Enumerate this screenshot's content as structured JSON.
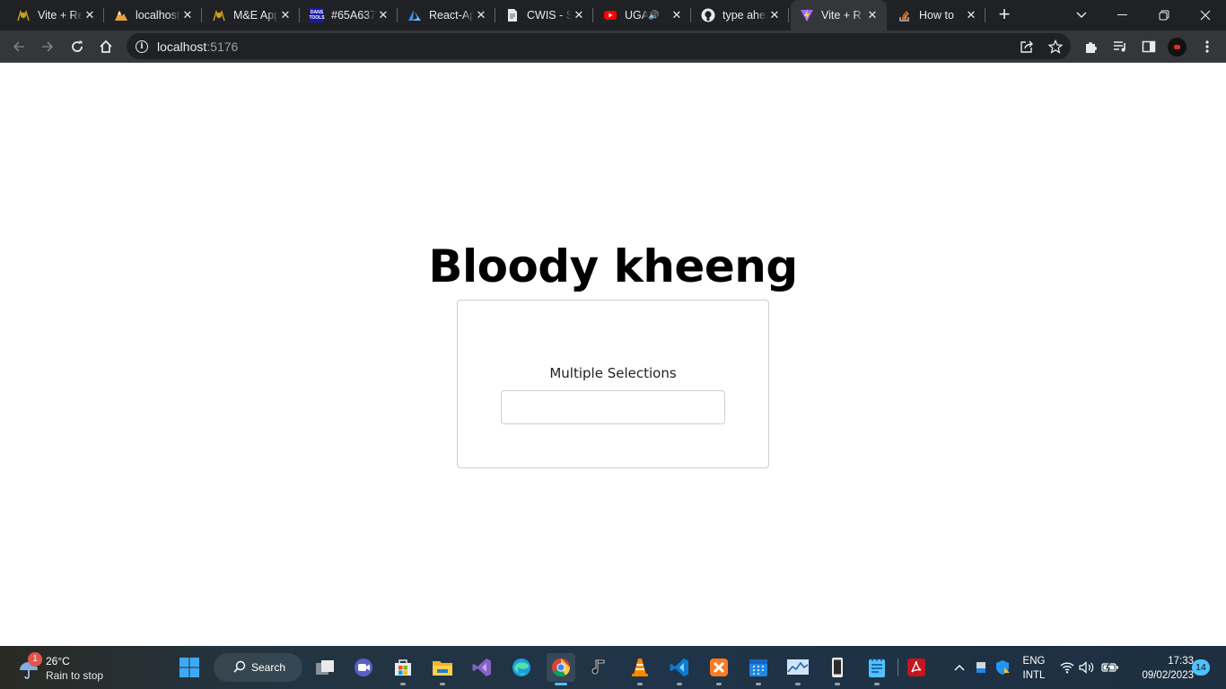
{
  "browser": {
    "tabs": [
      {
        "title": "Vite + React",
        "favicon": "uganda-coat-of-arms-icon"
      },
      {
        "title": "localhost",
        "favicon": "mountain-logo-icon"
      },
      {
        "title": "M&E App",
        "favicon": "uganda-coat-of-arms-icon"
      },
      {
        "title": "#65A637",
        "favicon": "dans-tools-icon",
        "favicon_text": "DANS TOOLS"
      },
      {
        "title": "React-App",
        "favicon": "azure-icon"
      },
      {
        "title": "CWIS - S",
        "favicon": "document-icon"
      },
      {
        "title": "UGA",
        "favicon": "youtube-icon",
        "audio": true
      },
      {
        "title": "type ahead",
        "favicon": "github-icon"
      },
      {
        "title": "Vite + R",
        "favicon": "vite-icon",
        "active": true
      },
      {
        "title": "How to",
        "favicon": "stackoverflow-icon"
      }
    ],
    "address": {
      "host": "localhost",
      "port": ":5176"
    }
  },
  "page": {
    "heading": "Bloody kheeng",
    "field_label": "Multiple Selections",
    "field_value": ""
  },
  "taskbar": {
    "weather": {
      "badge": "1",
      "temp": "26°C",
      "condition": "Rain to stop"
    },
    "search_label": "Search",
    "language": [
      "ENG",
      "INTL"
    ],
    "time": "17:33",
    "date": "09/02/2023",
    "notifications": "14"
  },
  "colors": {
    "tabstrip": "#202124",
    "toolbar": "#35363a",
    "omnibox": "#202124",
    "accent": "#4cc2ff"
  }
}
